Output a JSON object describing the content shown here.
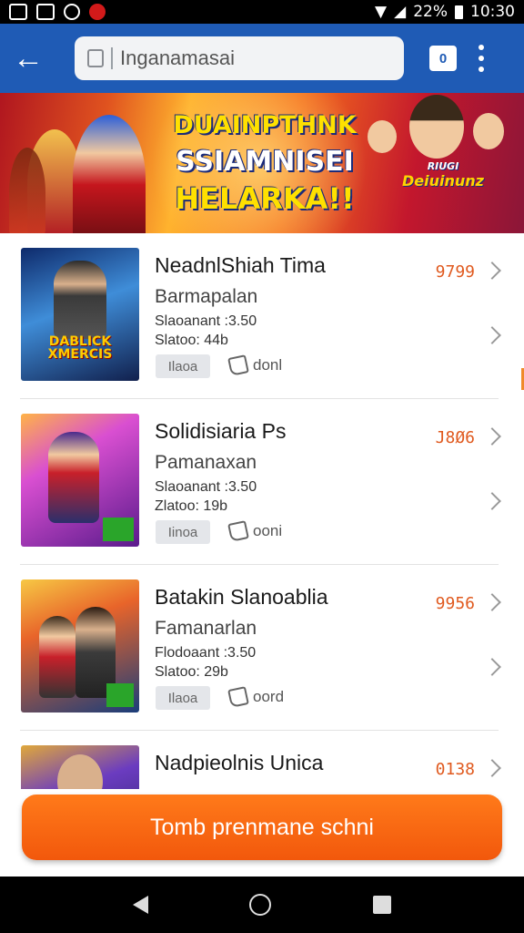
{
  "status_bar": {
    "battery": "22%",
    "time": "10:30"
  },
  "app_bar": {
    "search_value": "Inganamasai",
    "tabs_count": "0"
  },
  "banner": {
    "title_line1": "DUAINPTHNK",
    "title_line2": "SSIAMNISEI",
    "title_line3": "HELARKA!!",
    "badge_small": "RIUGI",
    "badge_main": "Deiuinunz"
  },
  "items": [
    {
      "title": "NeadnlShiah Tima",
      "subtitle": "Barmapalan",
      "meta1": "Slaoanant :3.50",
      "meta2": "Slatoo: 44b",
      "tag": "Ilaoa",
      "like": "donl",
      "price": "9799",
      "thumb_label": "DABLICK XMERCIS",
      "thumb_colors": [
        "#0e2a6b",
        "#3f8dd8",
        "#f2b01e"
      ]
    },
    {
      "title": "Solidisiaria Ps",
      "subtitle": "Pamanaxan",
      "meta1": "Slaoanant :3.50",
      "meta2": "Zlatoo: 19b",
      "tag": "Iinoa",
      "like": "ooni",
      "price": "J8Ø6",
      "thumb_label": "",
      "thumb_colors": [
        "#5a1b8c",
        "#d94fd1",
        "#ffb347"
      ]
    },
    {
      "title": "Batakin Slanoablia",
      "subtitle": "Famanarlan",
      "meta1": "Flodoaant :3.50",
      "meta2": "Slatoo: 29b",
      "tag": "Ilaoa",
      "like": "oord",
      "price": "9956",
      "thumb_label": "",
      "thumb_colors": [
        "#1a3d7a",
        "#e8642a",
        "#f7c844"
      ]
    },
    {
      "title": "Nadpieolnis Unica",
      "subtitle": "",
      "meta1": "",
      "meta2": "",
      "tag": "",
      "like": "",
      "price": "0138",
      "thumb_label": "",
      "thumb_colors": [
        "#1b1a55",
        "#6b3cc0",
        "#e0a83a"
      ]
    }
  ],
  "cta": {
    "label": "Tomb prenmane schni"
  },
  "colors": {
    "app_bar": "#1f5bb5",
    "cta": "#f2580c",
    "price": "#e05a1f"
  }
}
